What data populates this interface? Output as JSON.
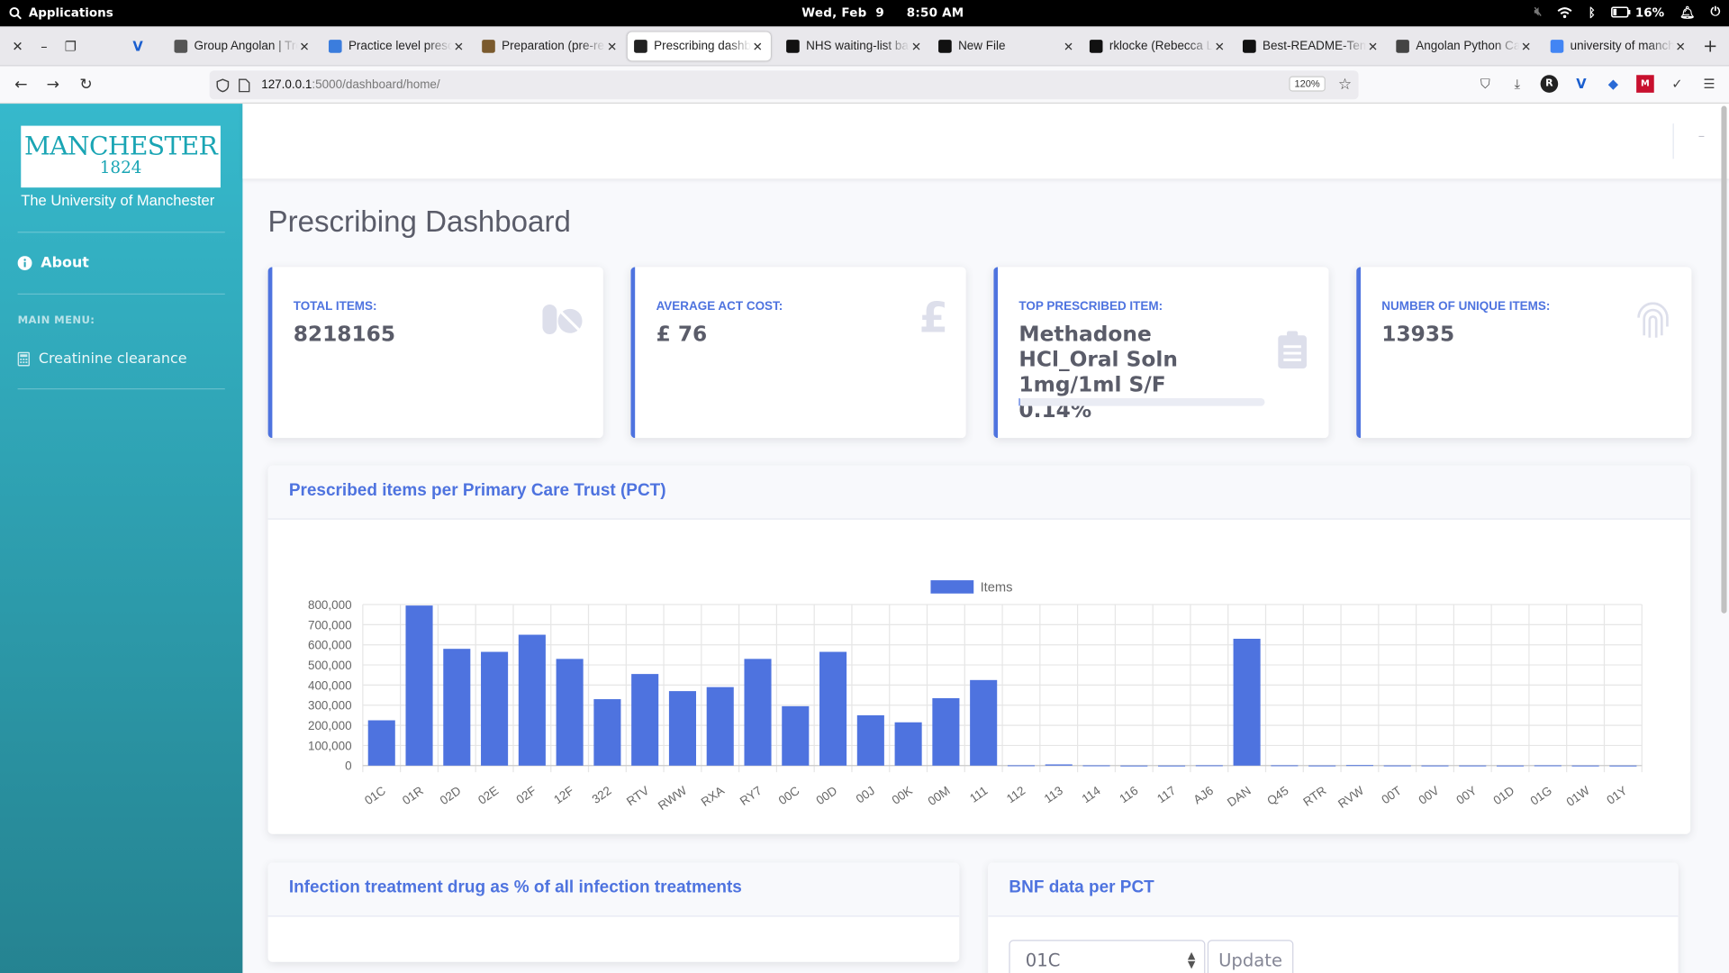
{
  "os_topbar": {
    "apps_label": "Applications",
    "clock": "Wed, Feb  9     8:50 AM",
    "battery": "16%"
  },
  "browser": {
    "tabs": [
      {
        "title": "Group Angolan | Trello",
        "favicon_color": "#555555"
      },
      {
        "title": "Practice level prescribing",
        "favicon_color": "#3b7ddd"
      },
      {
        "title": "Preparation (pre-reading)",
        "favicon_color": "#7a5a2e"
      },
      {
        "title": "Prescribing dashboard",
        "favicon_color": "#222222",
        "active": true
      },
      {
        "title": "NHS waiting-list backlog",
        "favicon_color": "#111111"
      },
      {
        "title": "New File",
        "favicon_color": "#111111"
      },
      {
        "title": "rklocke (Rebecca Locke)",
        "favicon_color": "#111111"
      },
      {
        "title": "Best-README-Template",
        "favicon_color": "#111111"
      },
      {
        "title": "Angolan Python Cal",
        "favicon_color": "#444444"
      },
      {
        "title": "university of manchester",
        "favicon_color": "#4285f4"
      }
    ],
    "url_host": "127.0.0.1",
    "url_rest": ":5000/dashboard/home/",
    "zoom": "120%"
  },
  "sidebar": {
    "logo_line1": "MANCHESTER",
    "logo_line2": "1824",
    "university": "The University of Manchester",
    "about": "About",
    "main_menu_heading": "MAIN MENU:",
    "creatinine": "Creatinine clearance"
  },
  "page_title": "Prescribing Dashboard",
  "cards": {
    "total_items": {
      "label": "TOTAL ITEMS:",
      "value": "8218165",
      "icon": "pills-icon"
    },
    "avg_cost": {
      "label": "AVERAGE ACT COST:",
      "value": "£ 76",
      "icon": "pound-icon"
    },
    "top_item": {
      "label": "TOP PRESCRIBED ITEM:",
      "value": "Methadone HCl_Oral Soln 1mg/1ml S/F",
      "percent": "0.14%",
      "progress": 0.0014,
      "icon": "clipboard-icon"
    },
    "unique_items": {
      "label": "NUMBER OF UNIQUE ITEMS:",
      "value": "13935",
      "icon": "fingerprint-icon"
    }
  },
  "pct_panel": {
    "title": "Prescribed items per Primary Care Trust (PCT)"
  },
  "chart_data": {
    "type": "bar",
    "title": "",
    "xlabel": "",
    "ylabel": "",
    "ylim": [
      0,
      800000
    ],
    "yticks": [
      0,
      100000,
      200000,
      300000,
      400000,
      500000,
      600000,
      700000,
      800000
    ],
    "ytick_labels": [
      "0",
      "100,000",
      "200,000",
      "300,000",
      "400,000",
      "500,000",
      "600,000",
      "700,000",
      "800,000"
    ],
    "legend_position": "top",
    "grid": true,
    "bar_color": "#4e73df",
    "categories": [
      "01C",
      "01R",
      "02D",
      "02E",
      "02F",
      "12F",
      "322",
      "RTV",
      "RWW",
      "RXA",
      "RY7",
      "00C",
      "00D",
      "00J",
      "00K",
      "00M",
      "111",
      "112",
      "113",
      "114",
      "116",
      "117",
      "AJ6",
      "DAN",
      "Q45",
      "RTR",
      "RVW",
      "00T",
      "00V",
      "00Y",
      "01D",
      "01G",
      "01W",
      "01Y"
    ],
    "series": [
      {
        "name": "Items",
        "values": [
          225000,
          795000,
          580000,
          565000,
          650000,
          530000,
          330000,
          455000,
          370000,
          390000,
          530000,
          295000,
          565000,
          250000,
          215000,
          335000,
          425000,
          1500,
          6000,
          1200,
          300,
          300,
          1500,
          630000,
          1500,
          600,
          2500,
          800,
          600,
          600,
          400,
          1200,
          400,
          300
        ]
      }
    ]
  },
  "infection_panel": {
    "title": "Infection treatment drug as % of all infection treatments"
  },
  "bnf_panel": {
    "title": "BNF data per PCT",
    "selected_pct": "01C",
    "update_label": "Update"
  }
}
